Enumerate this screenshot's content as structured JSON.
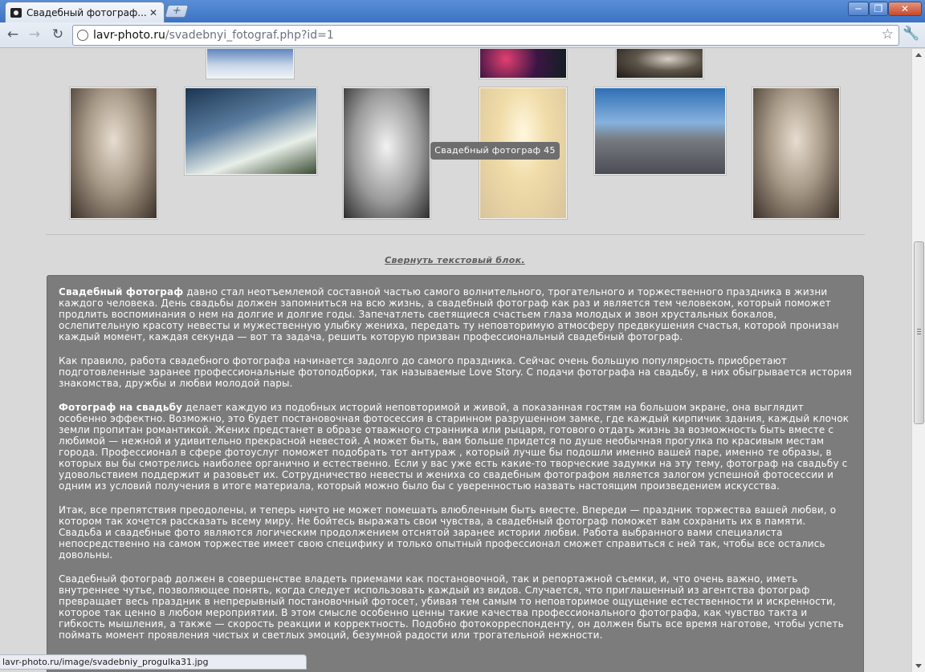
{
  "browser": {
    "tab_title": "Свадебный фотограф....",
    "tab_close": "✕",
    "new_tab": "+",
    "url_domain": "lavr-photo.ru",
    "url_path": "/svadebnyi_fotograf.php?id=1",
    "status_url": "lavr-photo.ru/image/svadebniy_progulka31.jpg",
    "window_buttons": {
      "minimize": "─",
      "maximize": "❐",
      "close": "✕"
    },
    "nav": {
      "back": "←",
      "forward": "→",
      "reload": "↻",
      "star": "☆",
      "wrench": "🔧"
    }
  },
  "gallery": {
    "tooltip": "Свадебный фотограф 45"
  },
  "collapse_link": "Свернуть текстовый блок.",
  "article": {
    "p1_bold": "Свадебный фотограф",
    "p1_rest": " давно стал неотъемлемой составной частью самого волнительного, трогательного и торжественного праздника в жизни каждого человека. День свадьбы должен запомниться на всю жизнь, а свадебный фотограф как раз и является тем человеком, который поможет продлить воспоминания о нем на долгие и долгие годы. Запечатлеть светящиеся счастьем глаза молодых и звон хрустальных бокалов, ослепительную красоту невесты и мужественную улыбку жениха, передать ту неповторимую атмосферу предвкушения счастья, которой пронизан каждый момент, каждая секунда — вот та задача, решить которую призван профессиональный свадебный фотограф.",
    "p2": "Как правило, работа свадебного фотографа начинается задолго до самого праздника. Сейчас очень большую популярность приобретают подготовленные заранее профессиональные фотоподборки, так называемые Love Story. С подачи фотографа на свадьбу, в них обыгрывается история знакомства, дружбы и любви молодой пары.",
    "p3_bold": "Фотограф на свадьбу",
    "p3_rest": " делает каждую из подобных историй неповторимой и живой, а показанная гостям на большом экране, она выглядит особенно эффектно. Возможно, это будет постановочная фотосессия в старинном разрушенном замке, где каждый кирпичик здания, каждый клочок земли пропитан романтикой. Жених предстанет в образе отважного странника или рыцаря, готового отдать жизнь за возможность быть вместе с любимой — нежной и удивительно прекрасной невестой. А может быть, вам больше придется по душе необычная прогулка по красивым местам города. Профессионал в сфере фотоуслуг поможет подобрать тот антураж , который лучше бы подошли именно вашей паре, именно те образы, в которых вы бы смотрелись наиболее органично и естественно. Если у вас уже есть какие-то творческие задумки на эту тему, фотограф на свадьбу с удовольствием поддержит и разовьет их. Сотрудничество невесты и жениха со свадебным фотографом является залогом успешной фотосессии и одним из условий получения в итоге материала, который можно было бы с уверенностью назвать настоящим произведением искусства.",
    "p4": "Итак, все препятствия преодолены, и теперь ничто не может помешать влюбленным быть вместе. Впереди — праздник торжества вашей любви, о котором так хочется рассказать всему миру. Не бойтесь выражать свои чувства, а свадебный фотограф поможет вам сохранить их в памяти. Свадьба и свадебные фото являются логическим продолжением отснятой заранее истории любви. Работа  выбранного вами специалиста  непосредственно на самом торжестве имеет свою специфику и только опытный профессионал сможет справиться с ней так, чтобы все остались довольны.",
    "p5": "Свадебный фотограф должен в совершенстве владеть приемами как постановочной, так и репортажной съемки, и, что очень важно, иметь внутреннее чутье, позволяющее понять, когда следует использовать каждый из видов. Случается, что приглашенный из агентства фотограф  превращает весь праздник в непрерывный постановочный фотосет, убивая тем самым то неповторимое ощущение естественности и искренности, которое так ценно в любом мероприятии. В этом смысле особенно ценны такие качества профессионального фотографа, как чувство такта и гибкость мышления, а также — скорость реакции и корректность. Подобно фотокорреспонденту, он должен быть все время наготове, чтобы успеть поймать момент проявления чистых и светлых эмоций, безумной радости или трогательной нежности."
  }
}
